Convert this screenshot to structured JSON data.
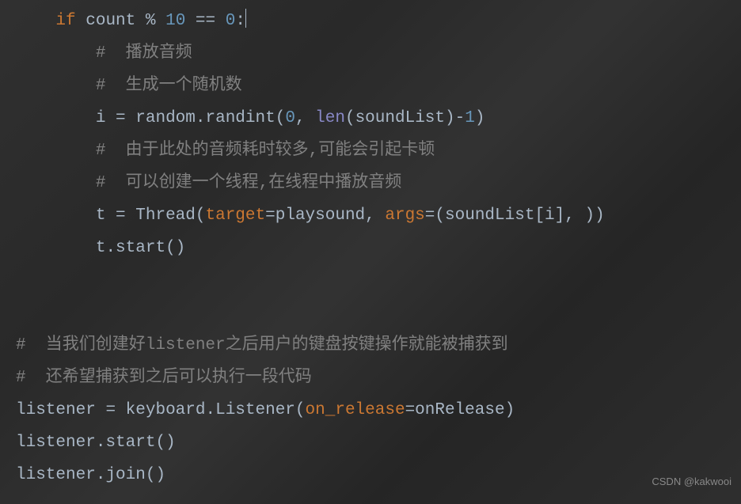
{
  "code": {
    "line1": {
      "indent": "    ",
      "kw_if": "if",
      "var_count": "count",
      "op_mod": "%",
      "num_10": "10",
      "op_eq": "==",
      "num_0": "0",
      "colon": ":"
    },
    "line2": {
      "indent": "        ",
      "comment": "#  播放音频"
    },
    "line3": {
      "indent": "        ",
      "comment": "#  生成一个随机数"
    },
    "line4": {
      "indent": "        ",
      "var_i": "i",
      "eq": "=",
      "random": "random",
      "dot1": ".",
      "randint": "randint",
      "lparen": "(",
      "num_0": "0",
      "comma": ", ",
      "len": "len",
      "lparen2": "(",
      "soundList": "soundList",
      "rparen2": ")",
      "minus": "-",
      "num_1": "1",
      "rparen": ")"
    },
    "line5": {
      "indent": "        ",
      "comment": "#  由于此处的音频耗时较多,可能会引起卡顿"
    },
    "line6": {
      "indent": "        ",
      "comment": "#  可以创建一个线程,在线程中播放音频"
    },
    "line7": {
      "indent": "        ",
      "var_t": "t",
      "eq": "=",
      "Thread": "Thread",
      "lparen": "(",
      "target": "target",
      "eq2": "=",
      "playsound": "playsound",
      "comma": ", ",
      "args": "args",
      "eq3": "=",
      "lparen2": "(",
      "soundList": "soundList",
      "lbracket": "[",
      "i": "i",
      "rbracket": "]",
      "comma2": ", ",
      "rparen2": ")",
      "rparen": ")"
    },
    "line8": {
      "indent": "        ",
      "var_t": "t",
      "dot": ".",
      "start": "start",
      "lparen": "(",
      "rparen": ")"
    },
    "line11": {
      "comment": "#  当我们创建好listener之后用户的键盘按键操作就能被捕获到"
    },
    "line12": {
      "comment": "#  还希望捕获到之后可以执行一段代码"
    },
    "line13": {
      "listener": "listener",
      "eq": "=",
      "keyboard": "keyboard",
      "dot": ".",
      "Listener": "Listener",
      "lparen": "(",
      "on_release": "on_release",
      "eq2": "=",
      "onRelease": "onRelease",
      "rparen": ")"
    },
    "line14": {
      "listener": "listener",
      "dot": ".",
      "start": "start",
      "lparen": "(",
      "rparen": ")"
    },
    "line15": {
      "listener": "listener",
      "dot": ".",
      "join": "join",
      "lparen": "(",
      "rparen": ")"
    }
  },
  "watermark": "CSDN @kakwooi"
}
